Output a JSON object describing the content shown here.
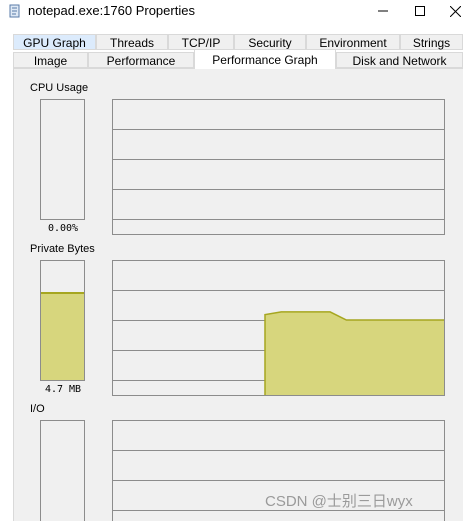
{
  "window": {
    "title": "notepad.exe:1760 Properties",
    "icon": "notepad-icon",
    "controls": [
      "minimize-icon",
      "maximize-icon",
      "close-icon"
    ]
  },
  "tabs": {
    "row1": [
      {
        "label": "GPU Graph",
        "highlighted": true
      },
      {
        "label": "Threads"
      },
      {
        "label": "TCP/IP"
      },
      {
        "label": "Security"
      },
      {
        "label": "Environment"
      },
      {
        "label": "Strings"
      }
    ],
    "row2": [
      {
        "label": "Image"
      },
      {
        "label": "Performance"
      },
      {
        "label": "Performance Graph",
        "active": true
      },
      {
        "label": "Disk and Network"
      }
    ]
  },
  "sections": {
    "cpu": {
      "label": "CPU Usage",
      "value": "0.00%",
      "meter_level": 0.0
    },
    "private_bytes": {
      "label": "Private Bytes",
      "value": "4.7 MB",
      "meter_level": 0.74,
      "history": [
        0.6,
        0.62,
        0.62,
        0.62,
        0.62,
        0.56,
        0.56,
        0.56,
        0.56,
        0.56,
        0.56,
        0.56
      ]
    },
    "io": {
      "label": "I/O"
    }
  },
  "watermark": "CSDN @士别三日wyx",
  "colors": {
    "graph_fill": "#d7d67d",
    "graph_line": "#a6a620",
    "grid": "#8c8c8c",
    "panel": "#f0f0f0",
    "tab_highlight": "#dcebfc"
  }
}
